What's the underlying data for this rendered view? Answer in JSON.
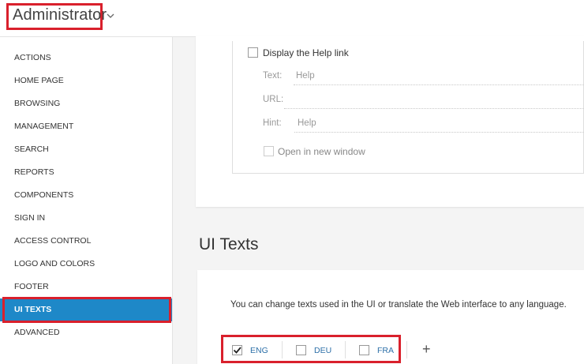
{
  "header": {
    "role_title": "Administrator"
  },
  "sidebar": {
    "items": [
      {
        "label": "ACTIONS"
      },
      {
        "label": "HOME PAGE"
      },
      {
        "label": "BROWSING"
      },
      {
        "label": "MANAGEMENT"
      },
      {
        "label": "SEARCH"
      },
      {
        "label": "REPORTS"
      },
      {
        "label": "COMPONENTS"
      },
      {
        "label": "SIGN IN"
      },
      {
        "label": "ACCESS CONTROL"
      },
      {
        "label": "LOGO AND COLORS"
      },
      {
        "label": "FOOTER"
      },
      {
        "label": "UI TEXTS",
        "active": true
      },
      {
        "label": "ADVANCED"
      }
    ]
  },
  "help_link": {
    "display_label": "Display the Help link",
    "display_checked": false,
    "text_label": "Text:",
    "text_value": "Help",
    "url_label": "URL:",
    "url_value": "",
    "hint_label": "Hint:",
    "hint_value": "Help",
    "new_window_label": "Open in new window",
    "new_window_checked": false
  },
  "ui_texts": {
    "title": "UI Texts",
    "description": "You can change texts used in the UI or translate the Web interface to any language.",
    "languages": [
      {
        "code": "ENG",
        "checked": true
      },
      {
        "code": "DEU",
        "checked": false
      },
      {
        "code": "FRA",
        "checked": false
      }
    ],
    "add_symbol": "+"
  },
  "colors": {
    "accent": "#1e88c8",
    "highlight": "#d9202c"
  }
}
